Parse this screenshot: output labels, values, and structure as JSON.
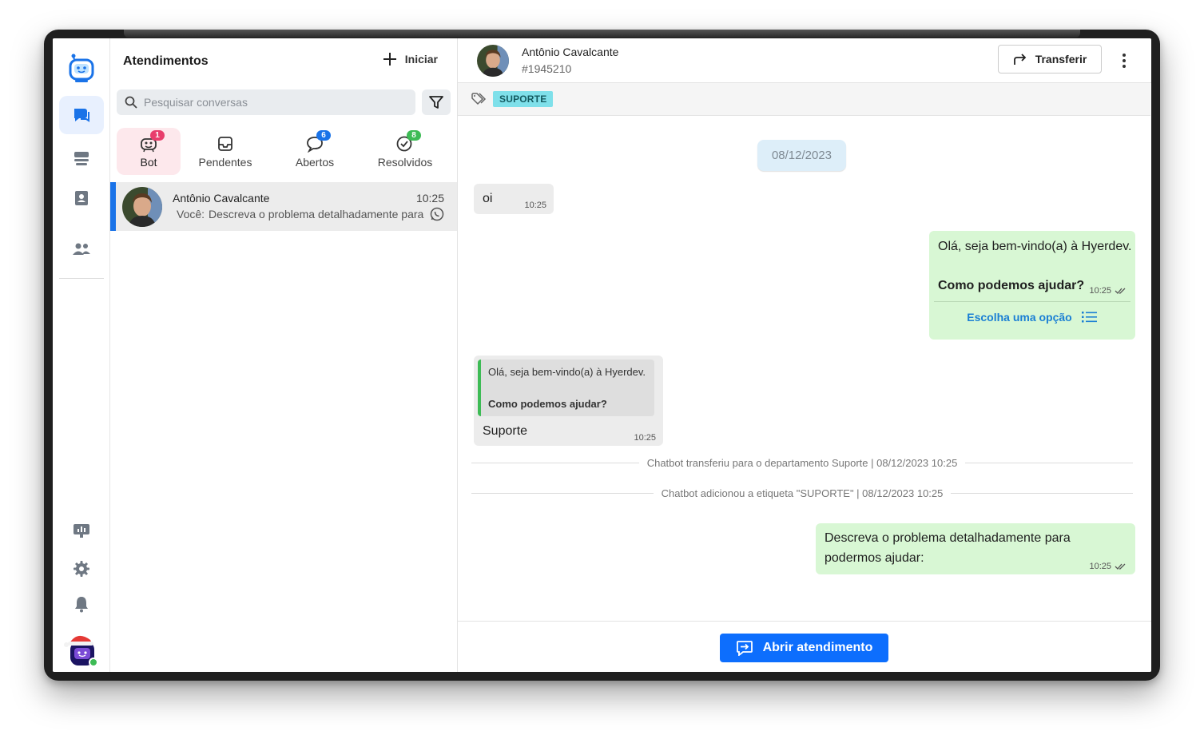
{
  "colors": {
    "accent": "#1a73e8",
    "bot_tab_bg": "#fde8ec",
    "outgoing_bubble": "#d8f7d4",
    "incoming_bubble": "#ececec",
    "tag_chip": "#7fe0ea",
    "primary_button": "#0d6efd"
  },
  "rail": {
    "items": [
      {
        "icon": "robot-logo-icon"
      },
      {
        "icon": "chat-bubbles-icon",
        "active": true
      },
      {
        "icon": "inbox-stack-icon"
      },
      {
        "icon": "contacts-book-icon"
      },
      {
        "icon": "team-users-icon"
      },
      {
        "icon": "dashboard-monitor-icon"
      },
      {
        "icon": "gear-icon"
      },
      {
        "icon": "bell-icon"
      },
      {
        "icon": "user-avatar-santa-icon"
      }
    ]
  },
  "panel": {
    "title": "Atendimentos",
    "start_label": "Iniciar",
    "search_placeholder": "Pesquisar conversas",
    "tabs": [
      {
        "label": "Bot",
        "badge": "1",
        "icon": "bot-face-icon",
        "active": true
      },
      {
        "label": "Pendentes",
        "badge": "",
        "icon": "inbox-tray-icon"
      },
      {
        "label": "Abertos",
        "badge": "6",
        "icon": "chat-bubble-icon"
      },
      {
        "label": "Resolvidos",
        "badge": "8",
        "icon": "check-circle-icon"
      }
    ],
    "conversations": [
      {
        "name": "Antônio Cavalcante",
        "time": "10:25",
        "sender": "Você:",
        "preview": "Descreva o problema detalhadamente para podermos ajudar:",
        "channel_icon": "whatsapp-icon"
      }
    ]
  },
  "chat": {
    "contact_name": "Antônio Cavalcante",
    "contact_id": "#1945210",
    "transfer_label": "Transferir",
    "tag": "SUPORTE",
    "date_chip": "08/12/2023",
    "messages": {
      "m1": {
        "text": "oi",
        "time": "10:25"
      },
      "m2": {
        "line1": "Olá, seja bem-vindo(a) à Hyerdev.",
        "line2": "Como podemos ajudar?",
        "time": "10:25",
        "option_label": "Escolha uma opção"
      },
      "m3": {
        "quote_line1": "Olá, seja bem-vindo(a) à Hyerdev.",
        "quote_line2": "Como podemos ajudar?",
        "text": "Suporte",
        "time": "10:25"
      },
      "m4": {
        "line1": "Descreva o problema detalhadamente para",
        "line2": "podermos ajudar:",
        "time": "10:25"
      }
    },
    "system_events": [
      "Chatbot transferiu para o departamento Suporte | 08/12/2023 10:25",
      "Chatbot adicionou a etiqueta \"SUPORTE\" | 08/12/2023 10:25"
    ],
    "open_button_label": "Abrir atendimento"
  }
}
